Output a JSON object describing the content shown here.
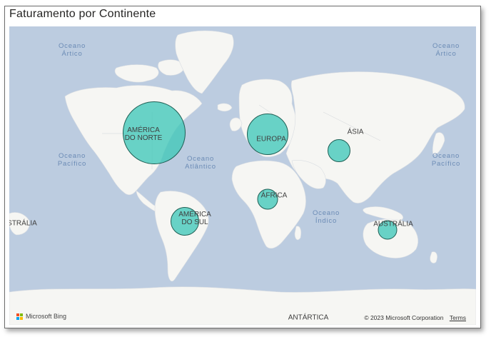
{
  "visual": {
    "title": "Faturamento por Continente"
  },
  "oceans": {
    "arctic_left": "Oceano\nÁrtico",
    "arctic_right": "Oceano\nÁrtico",
    "pacific_left": "Oceano\nPacífico",
    "atlantic": "Oceano\nAtlântico",
    "pacific_right": "Oceano\nPacífico",
    "indian": "Oceano\nÍndico"
  },
  "regions": {
    "north_america": "AMÉRICA\nDO NORTE",
    "europe": "EUROPA",
    "asia": "ÁSIA",
    "africa": "ÁFRICA",
    "south_america": "AMÉRICA\nDO SUL",
    "australia_left": "STRÁLIA",
    "australia": "AUSTRÁLIA",
    "antarctica": "ANTÁRTICA"
  },
  "chart_data": {
    "type": "bubble-map",
    "title": "Faturamento por Continente",
    "bubble_color": "#40c8b8",
    "series": [
      {
        "name": "AMÉRICA DO NORTE",
        "relative_size": 1.0
      },
      {
        "name": "EUROPA",
        "relative_size": 0.66
      },
      {
        "name": "AMÉRICA DO SUL",
        "relative_size": 0.46
      },
      {
        "name": "ÁSIA",
        "relative_size": 0.37
      },
      {
        "name": "ÁFRICA",
        "relative_size": 0.33
      },
      {
        "name": "AUSTRÁLIA",
        "relative_size": 0.31
      }
    ]
  },
  "attribution": {
    "provider": "Microsoft Bing",
    "copyright": "© 2023 Microsoft Corporation",
    "terms": "Terms"
  }
}
